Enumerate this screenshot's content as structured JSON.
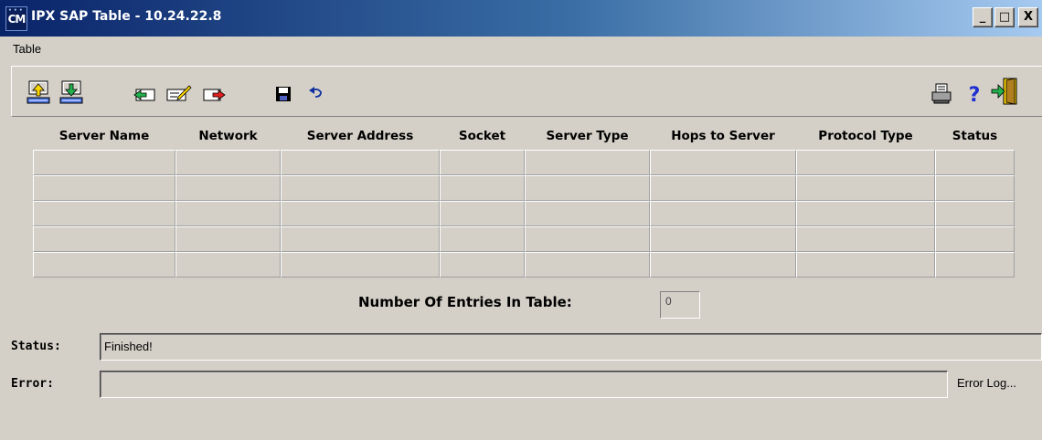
{
  "window": {
    "title": "IPX SAP Table - 10.24.22.8",
    "app_icon_text": "CM",
    "minimize": "_",
    "maximize": "□",
    "close": "X"
  },
  "menu": {
    "items": [
      "Table"
    ]
  },
  "toolbar": {
    "left_icons": [
      "upload-icon",
      "download-icon",
      "insert-row-icon",
      "edit-row-icon",
      "delete-row-icon",
      "save-icon",
      "undo-icon"
    ],
    "right_icons": [
      "print-icon",
      "help-icon",
      "exit-icon"
    ]
  },
  "table": {
    "columns": [
      "Server Name",
      "Network",
      "Server Address",
      "Socket",
      "Server Type",
      "Hops to Server",
      "Protocol Type",
      "Status"
    ],
    "rows": [
      [
        "",
        "",
        "",
        "",
        "",
        "",
        "",
        ""
      ],
      [
        "",
        "",
        "",
        "",
        "",
        "",
        "",
        ""
      ],
      [
        "",
        "",
        "",
        "",
        "",
        "",
        "",
        ""
      ],
      [
        "",
        "",
        "",
        "",
        "",
        "",
        "",
        ""
      ],
      [
        "",
        "",
        "",
        "",
        "",
        "",
        "",
        ""
      ]
    ]
  },
  "entries": {
    "label": "Number Of Entries In Table:",
    "value": "0"
  },
  "status": {
    "label": "Status:",
    "value": "Finished!"
  },
  "error": {
    "label": "Error:",
    "value": "",
    "log_button": "Error Log..."
  },
  "colors": {
    "titlebar_start": "#0a246a",
    "titlebar_end": "#a6caf0",
    "face": "#d4d0c8"
  }
}
